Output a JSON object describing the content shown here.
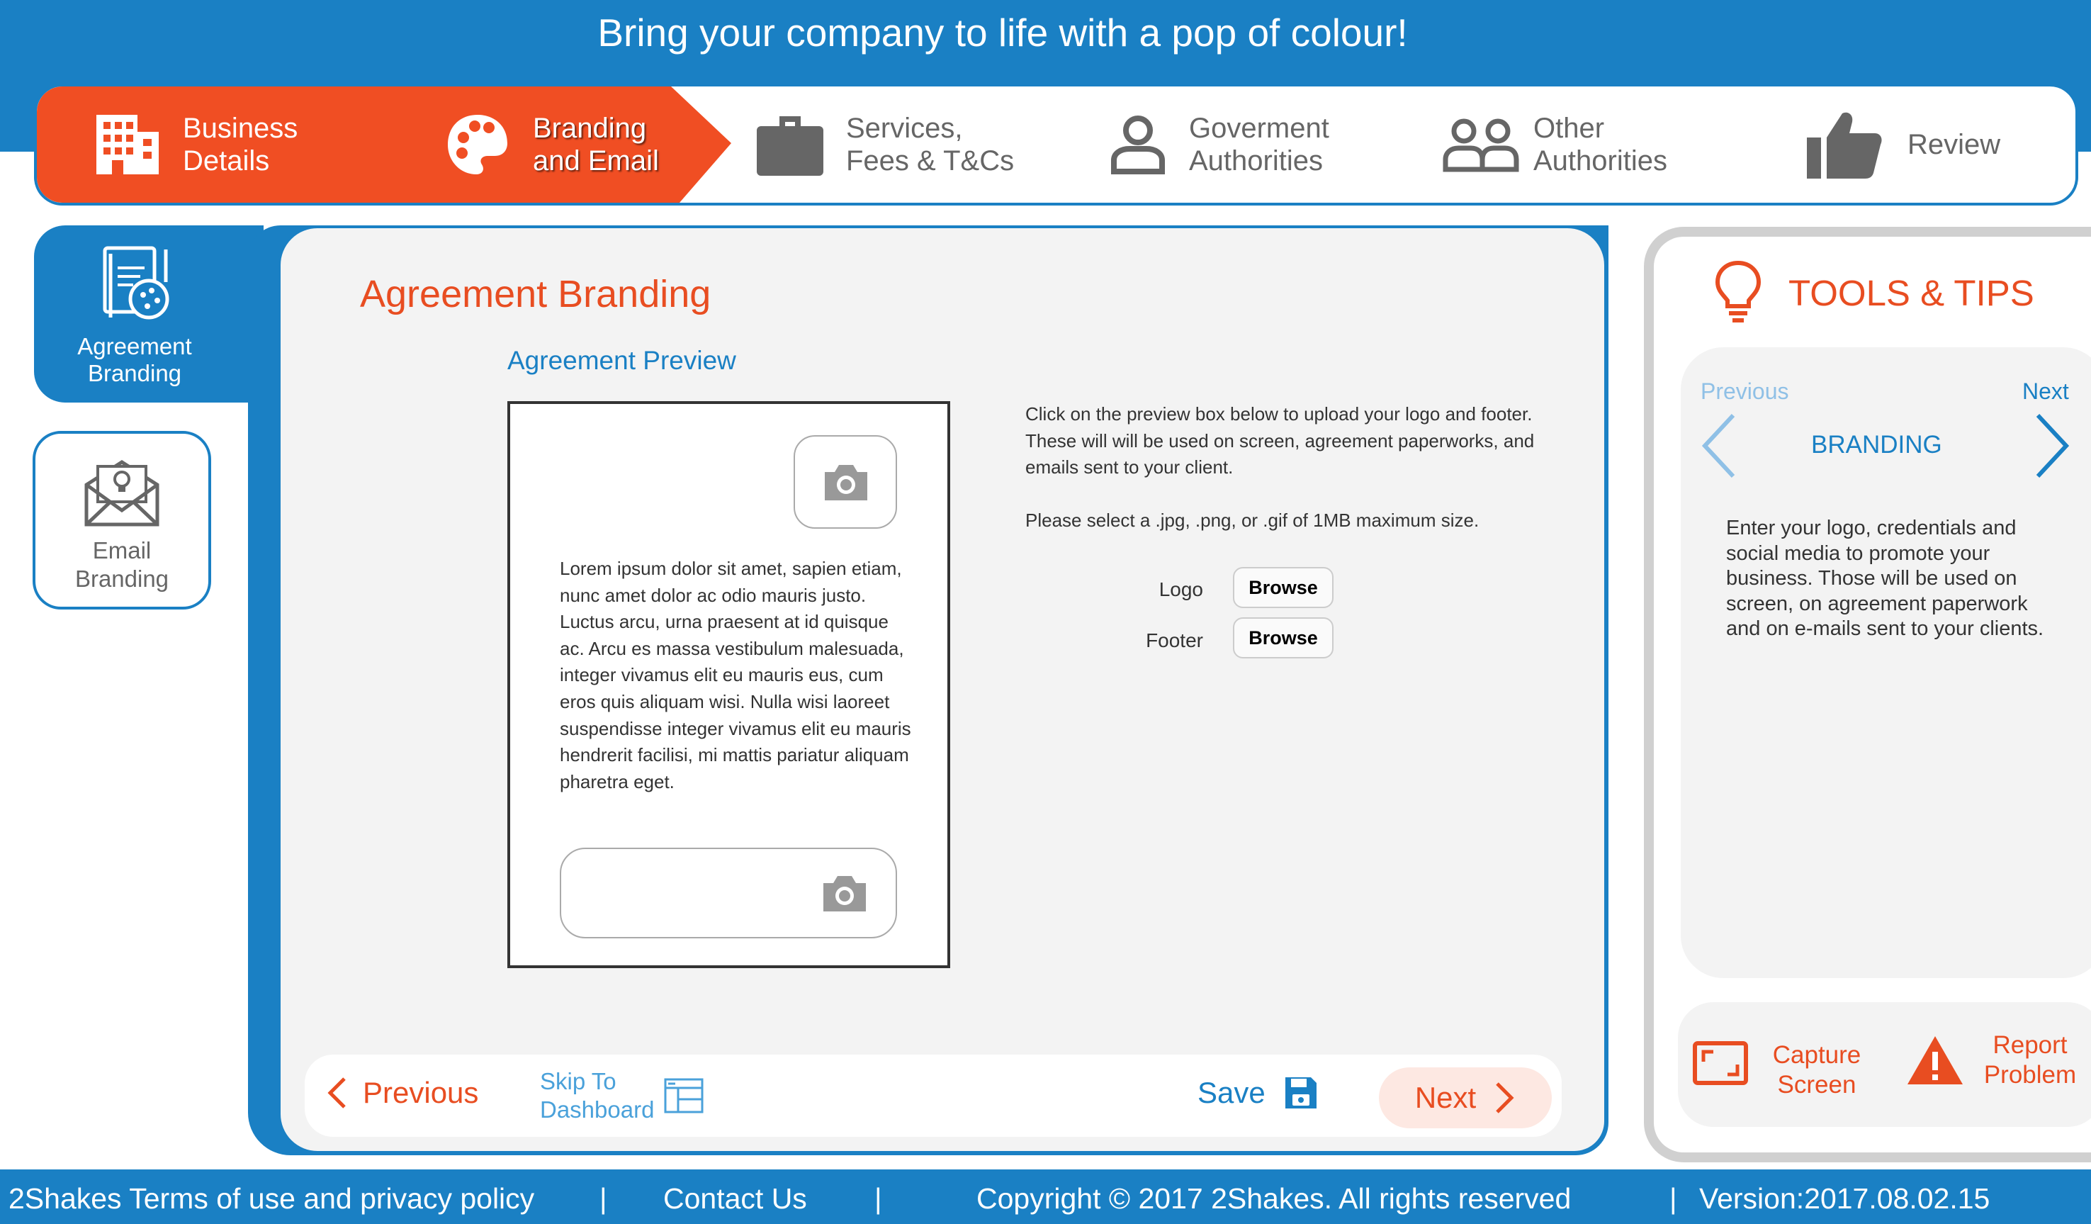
{
  "header": {
    "title": "Bring your company to life with a pop of colour!"
  },
  "steps": [
    {
      "label": "Business\nDetails",
      "icon": "building-icon",
      "active": true
    },
    {
      "label": "Branding\nand Email",
      "icon": "palette-icon",
      "active": true,
      "current": true
    },
    {
      "label": "Services,\nFees & T&Cs",
      "icon": "briefcase-icon",
      "active": false
    },
    {
      "label": "Goverment\nAuthorities",
      "icon": "person-icon",
      "active": false
    },
    {
      "label": "Other\nAuthorities",
      "icon": "people-icon",
      "active": false
    },
    {
      "label": "Review",
      "icon": "thumbs-up-icon",
      "active": false
    }
  ],
  "subnav": {
    "items": [
      {
        "label": "Agreement\nBranding",
        "icon": "document-palette-icon",
        "active": true
      },
      {
        "label": "Email\nBranding",
        "icon": "envelope-lightbulb-icon",
        "active": false
      }
    ]
  },
  "main": {
    "title": "Agreement Branding",
    "preview_title": "Agreement Preview",
    "preview_text": "Lorem ipsum dolor sit amet, sapien etiam, nunc amet dolor ac odio mauris justo. Luctus arcu, urna praesent at id quisque ac. Arcu es massa vestibulum malesuada, integer vivamus elit eu mauris eus, cum eros quis aliquam wisi. Nulla wisi laoreet suspendisse integer vivamus elit eu mauris hendrerit facilisi, mi mattis pariatur aliquam pharetra eget.",
    "instructions": "Click on the preview box below to upload your logo and footer. These will will be used on screen, agreement paperworks, and emails sent to your client.\n\nPlease select a .jpg, .png, or .gif of 1MB maximum size.",
    "uploads": [
      {
        "label": "Logo",
        "button": "Browse"
      },
      {
        "label": "Footer",
        "button": "Browse"
      }
    ]
  },
  "actions": {
    "previous": "Previous",
    "skip": "Skip To\nDashboard",
    "save": "Save",
    "next": "Next"
  },
  "tips": {
    "title": "TOOLS & TIPS",
    "previous": "Previous",
    "next": "Next",
    "topic": "BRANDING",
    "body": "Enter your logo, credentials and social media to promote your business. Those will be used on screen, on agreement paperwork and on e-mails sent to your clients.",
    "capture": "Capture\nScreen",
    "report": "Report\nProblem"
  },
  "footer": {
    "terms": "2Shakes Terms of use and privacy policy",
    "separator": "|",
    "contact": "Contact Us",
    "copyright": "Copyright © 2017 2Shakes. All rights reserved",
    "version": "Version:2017.08.02.15"
  },
  "colors": {
    "brand_blue": "#1a80c4",
    "accent_orange": "#f04e23",
    "panel_gray": "#f3f3f3"
  }
}
